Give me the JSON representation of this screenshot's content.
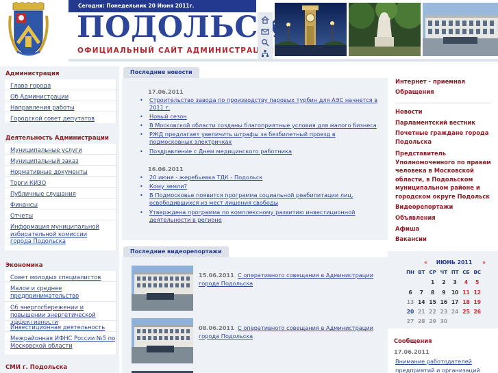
{
  "header": {
    "date_label": "Сегодня: Понедельник 20 Июня 2011г.",
    "city_title": "ПОДОЛЬСК",
    "subtitle": "ОФИЦИАЛЬНЫЙ САЙТ АДМИНИСТРАЦИИ",
    "icons": [
      "home-icon",
      "mail-icon",
      "search-icon",
      "sitemap-icon"
    ]
  },
  "left_menu": {
    "sections": [
      {
        "title": "Администрация",
        "items": [
          "Глава города",
          "Об Администрации",
          "Направления работы",
          "Городской совет депутатов"
        ]
      },
      {
        "title": "Деятельность Администрации",
        "items": [
          "Муниципальные услуги",
          "Муниципальный заказ",
          "Нормативные документы",
          "Торги КИЗО",
          "Публичные слушания",
          "Финансы",
          "Отчеты",
          "Информация муниципальной избирательной комиссии города Подольска"
        ]
      },
      {
        "title": "Экономика",
        "items": [
          "Совет молодых специалистов",
          "Малое и среднее предпринимательство",
          "Об энергосбережении и повышении энергетической эффективности",
          "Инвестиционная деятельность",
          "Межрайонная ИФНС России №5 по Московской области"
        ]
      },
      {
        "title": "СМИ г. Подольска",
        "items": []
      }
    ]
  },
  "news": {
    "tab_label": "Последние новости",
    "groups": [
      {
        "date": "17.06.2011",
        "items": [
          "Строительство завода по производству паровых турбин для АЭС начнется в 2011 г.",
          "Новый сезон",
          "В Московской области созданы благоприятные условия для малого бизнеса",
          "РЖД предлагает увеличить штрафы за безбилетный проезд в подмосковных электричках",
          "Поздравление с Днем медицинского работника"
        ]
      },
      {
        "date": "16.06.2011",
        "items": [
          "20 июня - жеребьевка ТДК - Подольск",
          "Кому земли?",
          "В Подмосковье появится программа социальной реабилитации лиц, освободившихся из мест лишения свободы",
          "Утверждена программа по комплексному развитию инвестиционной деятельности в регионе"
        ]
      }
    ]
  },
  "videos": {
    "tab_label": "Последние видеорепортажи",
    "items": [
      {
        "date": "15.06.2011",
        "title": "С оперативного совещания в Администрации города Подольска"
      },
      {
        "date": "08.06.2011",
        "title": "С оперативного совещания в Администрации города Подольска"
      }
    ]
  },
  "right_menu": {
    "group1": [
      "Интернет - приемная",
      "Обращения"
    ],
    "group2": [
      "Новости",
      "Парламентский вестник",
      "Почетные граждане города Подольска",
      "Представитель Уполномоченного по правам человека в Московской области, в Подольском муниципальном районе и городском округе Подольск",
      "Видеорепортажи",
      "Объявления",
      "Афиша",
      "Вакансии"
    ]
  },
  "calendar": {
    "prev": "«",
    "next": "»",
    "month_label": "ИЮНЬ 2011",
    "weekdays": [
      "ПН",
      "ВТ",
      "СР",
      "ЧТ",
      "ПТ",
      "СБ",
      "ВС"
    ],
    "weeks": [
      [
        "",
        "",
        "1",
        "2",
        "3",
        "4",
        "5"
      ],
      [
        "6",
        "7",
        "8",
        "9",
        "10",
        "11",
        "12"
      ],
      [
        "13",
        "14",
        "15",
        "16",
        "17",
        "18",
        "19"
      ],
      [
        "20",
        "21",
        "22",
        "23",
        "24",
        "25",
        "26"
      ],
      [
        "27",
        "28",
        "29",
        "30",
        "",
        "",
        ""
      ]
    ],
    "today": "20",
    "colors": {
      "weekend": "#d2262c",
      "today": "#2d4597",
      "past": "#999999",
      "normal": "#333333",
      "header": "#23388f"
    }
  },
  "messages": {
    "title": "Сообщения",
    "date": "17.06.2011",
    "link": "Внимание работодателей предприятий и организаций"
  },
  "colors": {
    "brand_blue": "#2d4597",
    "accent_red": "#b0262c",
    "section_red": "#8e1e26",
    "panel_bg": "#eef1f6"
  }
}
